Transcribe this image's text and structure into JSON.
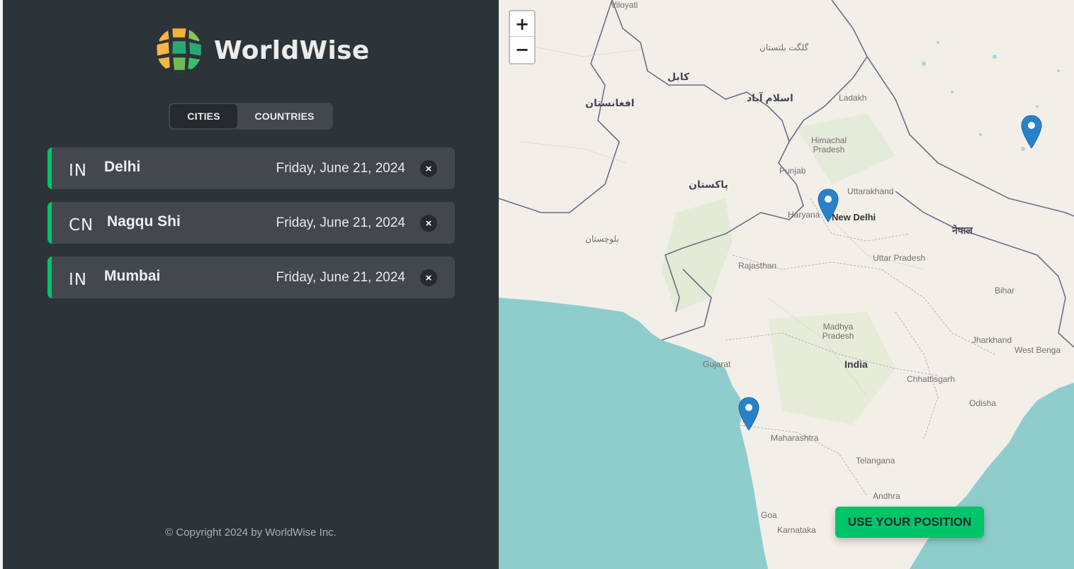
{
  "app": {
    "name": "WorldWise",
    "copyright": "© Copyright 2024 by WorldWise Inc."
  },
  "tabs": [
    {
      "label": "CITIES",
      "active": true
    },
    {
      "label": "COUNTRIES",
      "active": false
    }
  ],
  "cities": [
    {
      "code": "IN",
      "name": "Delhi",
      "date": "Friday, June 21, 2024",
      "delete_label": "×"
    },
    {
      "code": "CN",
      "name": "Nagqu Shi",
      "date": "Friday, June 21, 2024",
      "delete_label": "×"
    },
    {
      "code": "IN",
      "name": "Mumbai",
      "date": "Friday, June 21, 2024",
      "delete_label": "×"
    }
  ],
  "map": {
    "zoom_in": "+",
    "zoom_out": "−",
    "use_position_label": "USE YOUR POSITION",
    "labels": {
      "afghanistan": "افغانستان",
      "pakistan": "پاکستان",
      "islamabad": "اسلام آباد",
      "kabul": "کابل",
      "new_delhi": "New Delhi",
      "india": "India",
      "nepal": "नेपाल",
      "ladakh": "Ladakh",
      "himachal": "Himachal Pradesh",
      "punjab": "Punjab",
      "haryana": "Haryana",
      "uttarakhand": "Uttarakhand",
      "uttar_pradesh": "Uttar Pradesh",
      "rajasthan": "Rajasthan",
      "madhya_pradesh": "Madhya Pradesh",
      "gujarat": "Gujarat",
      "maharashtra": "Maharashtra",
      "telangana": "Telangana",
      "andhra": "Andhra",
      "karnataka": "Karnataka",
      "chhattisgarh": "Chhattisgarh",
      "odisha": "Odisha",
      "jharkhand": "Jharkhand",
      "bihar": "Bihar",
      "west_bengal": "West Benga",
      "goa": "Goa",
      "balochistan": "بلوچستان",
      "gilgit": "گلگت بلتستان",
      "viloyati": "Viloyati"
    },
    "colors": {
      "land": "#f2efe9",
      "sea": "#8fcdcd",
      "border": "#6b6f86",
      "marker": "#2a81cb",
      "accent": "#00c46a"
    }
  }
}
